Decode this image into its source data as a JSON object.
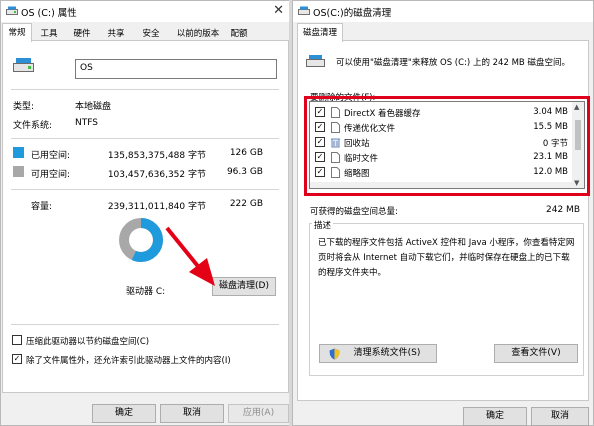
{
  "colors": {
    "used": "#1f9bdd",
    "free": "#a8a8a8",
    "highlight": "#e0001b",
    "arrow": "#e40016"
  },
  "left_window": {
    "title": "OS (C:) 属性",
    "tabs": [
      "常规",
      "工具",
      "硬件",
      "共享",
      "安全",
      "以前的版本",
      "配额"
    ],
    "drive_name": "OS",
    "type_label": "类型:",
    "type_value": "本地磁盘",
    "fs_label": "文件系统:",
    "fs_value": "NTFS",
    "used_label": "已用空间:",
    "used_bytes": "135,853,375,488 字节",
    "used_gb": "126 GB",
    "free_label": "可用空间:",
    "free_bytes": "103,457,636,352 字节",
    "free_gb": "96.3 GB",
    "capacity_label": "容量:",
    "capacity_bytes": "239,311,011,840 字节",
    "capacity_gb": "222 GB",
    "used_fraction": 0.568,
    "drive_label": "驱动器 C:",
    "cleanup_button": "磁盘清理(D)",
    "compress_option": "压缩此驱动器以节约磁盘空间(C)",
    "compress_checked": false,
    "index_option": "除了文件属性外，还允许索引此驱动器上文件的内容(I)",
    "index_checked": true,
    "ok": "确定",
    "cancel": "取消",
    "apply": "应用(A)"
  },
  "right_window": {
    "title": "OS(C:)的磁盘清理",
    "tab": "磁盘清理",
    "intro": "可以使用\"磁盘清理\"来释放 OS (C:) 上的 242 MB 磁盘空间。",
    "list_label": "要删除的文件(F):",
    "files": [
      {
        "name": "DirectX 着色器缓存",
        "size": "3.04 MB",
        "checked": true,
        "icon": "file-icon"
      },
      {
        "name": "传递优化文件",
        "size": "15.5 MB",
        "checked": true,
        "icon": "file-icon"
      },
      {
        "name": "回收站",
        "size": "0 字节",
        "checked": true,
        "icon": "recycle-bin-icon"
      },
      {
        "name": "临时文件",
        "size": "23.1 MB",
        "checked": true,
        "icon": "file-icon"
      },
      {
        "name": "缩略图",
        "size": "12.0 MB",
        "checked": true,
        "icon": "file-icon"
      }
    ],
    "gain_label": "可获得的磁盘空间总量:",
    "gain_value": "242 MB",
    "desc_title": "描述",
    "desc_text": [
      "已下载的程序文件包括 ActiveX 控件和 Java 小程序，你查看特定网",
      "页时将会从 Internet 自动下载它们，并临时保存在硬盘上的已下载",
      "的程序文件夹中。"
    ],
    "clean_system_button": "清理系统文件(S)",
    "view_files_button": "查看文件(V)",
    "ok": "确定",
    "cancel": "取消"
  }
}
